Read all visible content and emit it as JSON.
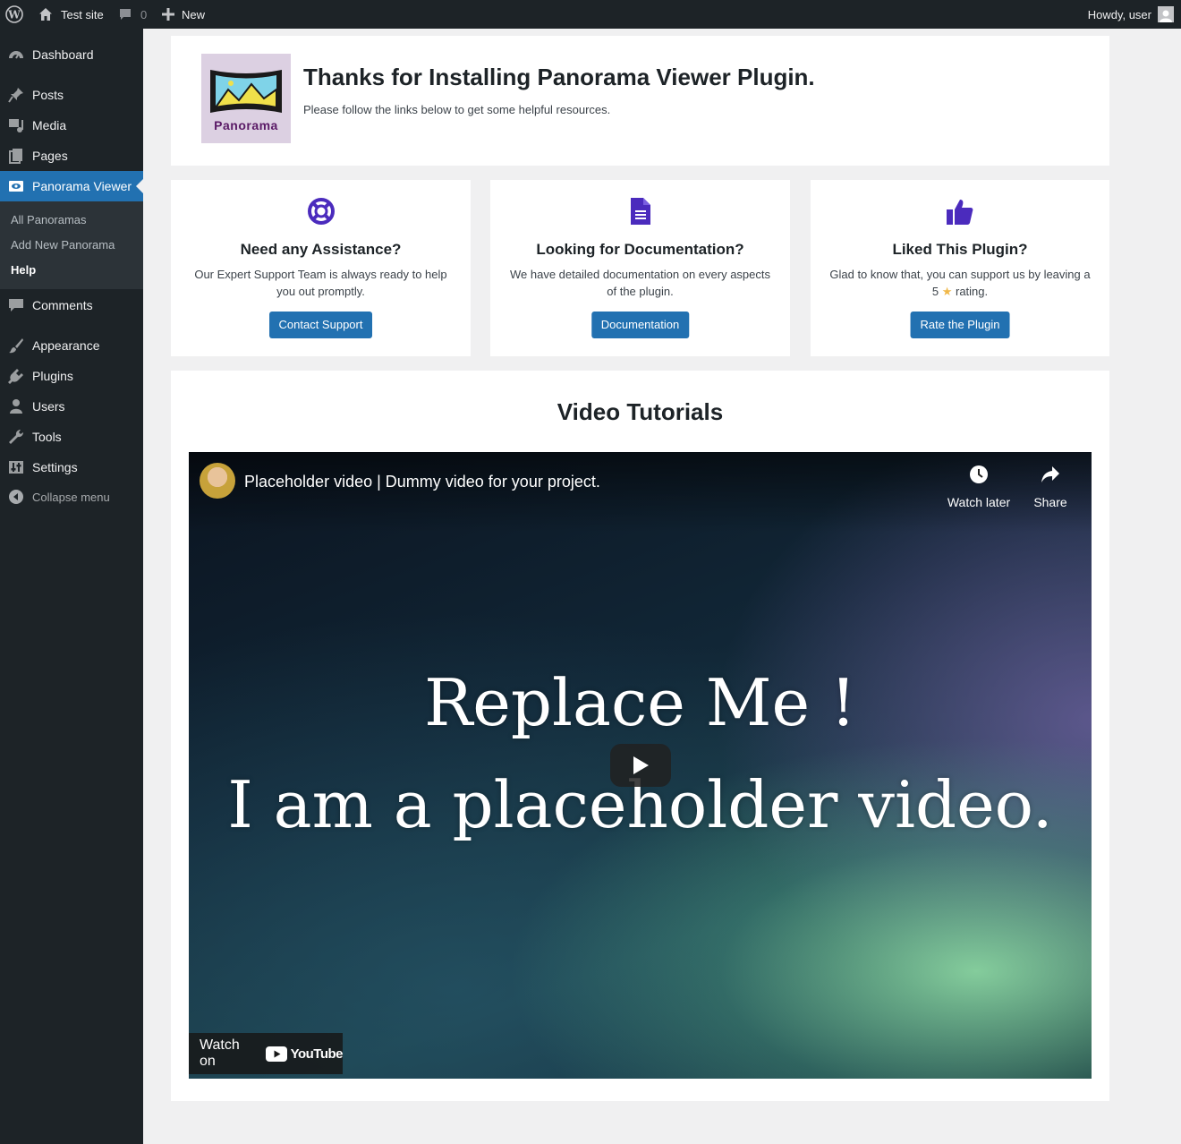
{
  "adminbar": {
    "site_name": "Test site",
    "comments_count": "0",
    "new_label": "New",
    "howdy": "Howdy, user"
  },
  "sidebar": {
    "items": [
      {
        "label": "Dashboard",
        "icon": "dashboard-icon"
      },
      {
        "label": "Posts",
        "icon": "pin-icon"
      },
      {
        "label": "Media",
        "icon": "media-icon"
      },
      {
        "label": "Pages",
        "icon": "pages-icon"
      },
      {
        "label": "Panorama Viewer",
        "icon": "eye-icon"
      },
      {
        "label": "Comments",
        "icon": "comment-icon"
      },
      {
        "label": "Appearance",
        "icon": "brush-icon"
      },
      {
        "label": "Plugins",
        "icon": "plugin-icon"
      },
      {
        "label": "Users",
        "icon": "user-icon"
      },
      {
        "label": "Tools",
        "icon": "wrench-icon"
      },
      {
        "label": "Settings",
        "icon": "settings-icon"
      }
    ],
    "submenu": [
      "All Panoramas",
      "Add New Panorama",
      "Help"
    ],
    "collapse_label": "Collapse menu"
  },
  "welcome": {
    "logo_text": "Panorama",
    "title": "Thanks for Installing Panorama Viewer Plugin.",
    "subtitle": "Please follow the links below to get some helpful resources."
  },
  "features": [
    {
      "title": "Need any Assistance?",
      "text": "Our Expert Support Team is always ready to help you out promptly.",
      "button": "Contact Support"
    },
    {
      "title": "Looking for Documentation?",
      "text": "We have detailed documentation on every aspects of the plugin.",
      "button": "Documentation"
    },
    {
      "title": "Liked This Plugin?",
      "text_before": "Glad to know that, you can support us by leaving a 5",
      "text_after": "rating.",
      "button": "Rate the Plugin"
    }
  ],
  "videos": {
    "heading": "Video Tutorials",
    "video_title": "Placeholder video | Dummy video for your project.",
    "watch_later": "Watch later",
    "share": "Share",
    "line1": "Replace Me !",
    "line2": "I am a placeholder video.",
    "watch_on": "Watch on",
    "youtube": "YouTube"
  },
  "colors": {
    "accent": "#2271b1",
    "icon_purple": "#4b2bbd",
    "admin_dark": "#1d2327",
    "star": "#f0b849"
  }
}
